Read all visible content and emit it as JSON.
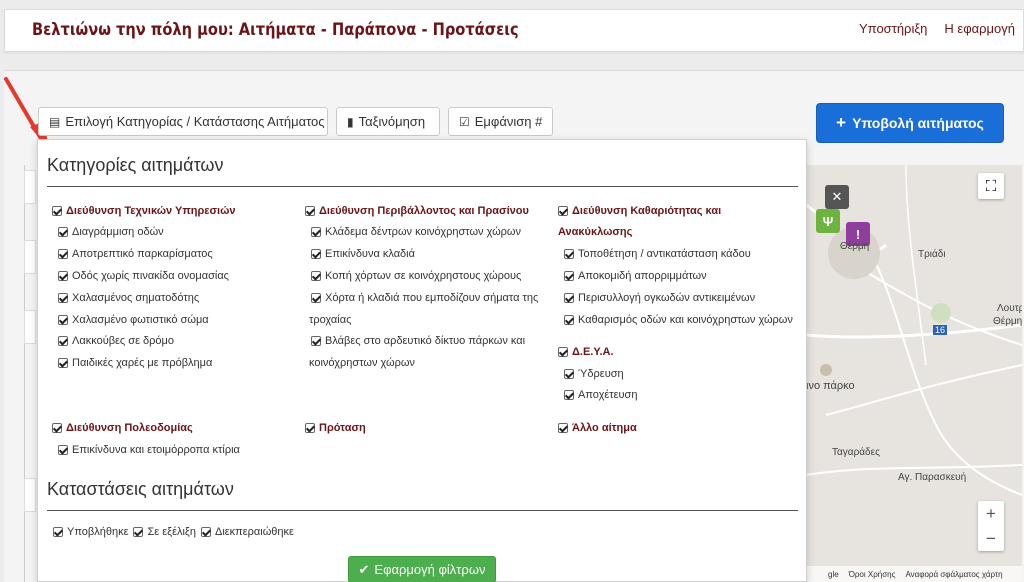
{
  "header": {
    "title": "Βελτιώνω την πόλη μου: Αιτήματα - Παράπονα - Προτάσεις",
    "nav": [
      "Υποστήριξη",
      "Η εφαρμογή"
    ]
  },
  "toolbar": {
    "category_btn": "Επιλογή Κατηγορίας / Κατάστασης Αιτήματος",
    "sort_btn": "Ταξινόμηση",
    "display_btn": "Εμφάνιση #",
    "submit_btn": "Υποβολή αιτήματος"
  },
  "filters": {
    "categories_title": "Κατηγορίες αιτημάτων",
    "statuses_title": "Καταστάσεις αιτημάτων",
    "apply_btn": "Εφαρμογή φίλτρων",
    "col1": {
      "head": "Διεύθυνση Τεχνικών Υπηρεσιών",
      "items": [
        "Διαγράμμιση οδών",
        "Αποτρεπτικό παρκαρίσματος",
        "Οδός χωρίς πινακίδα ονομασίας",
        "Χαλασμένος σηματοδότης",
        "Χαλασμένο φωτιστικό σώμα",
        "Λακκούβες σε δρόμο",
        "Παιδικές χαρές με πρόβλημα"
      ]
    },
    "col2": {
      "head": "Διεύθυνση Περιβάλλοντος και Πρασίνου",
      "items": [
        "Κλάδεμα δέντρων κοινόχρηστων χώρων",
        "Επικίνδυνα κλαδιά",
        "Κοπή χόρτων σε κοινόχρηστους χώρους",
        "Χόρτα ή κλαδιά που εμποδίζουν σήματα της",
        "τροχαίας",
        "Βλάβες στο αρδευτικό δίκτυο πάρκων και",
        "κοινόχρηστων χώρων"
      ]
    },
    "col3": {
      "head1": "Διεύθυνση Καθαριότητας και",
      "head2": "Ανακύκλωσης",
      "items": [
        "Τοποθέτηση / αντικατάσταση κάδου",
        "Αποκομιδή απορριμμάτων",
        "Περισυλλογή ογκωδών αντικειμένων",
        "Καθαρισμός οδών και κοινόχρηστων χώρων"
      ],
      "deya_head": "Δ.Ε.Υ.Α.",
      "deya_items": [
        "Ύδρευση",
        "Αποχέτευση"
      ]
    },
    "row2": {
      "pol_head": "Διεύθυνση Πολεοδομίας",
      "pol_items": [
        "Επικίνδυνα και ετοιμόρροπα κτίρια"
      ],
      "proposal_head": "Πρόταση",
      "other_head": "Άλλο αίτημα"
    },
    "statuses": [
      "Υποβλήθηκε",
      "Σε εξέλιξη",
      "Διεκπεραιώθηκε"
    ]
  },
  "map": {
    "labels": [
      "Θέρμη",
      "Τριάδι",
      "Λουτρ.",
      "Θέρμη",
      "16",
      "ινο πάρκο",
      "Ταγαράδες",
      "Αγ. Παρασκευή"
    ],
    "footer": [
      "gle",
      "Όροι Χρήσης",
      "Αναφορά σφάλματος χάρτη"
    ]
  },
  "colors": {
    "brand": "#6b1518",
    "primary": "#1a6ed8",
    "success": "#4cae4c"
  }
}
